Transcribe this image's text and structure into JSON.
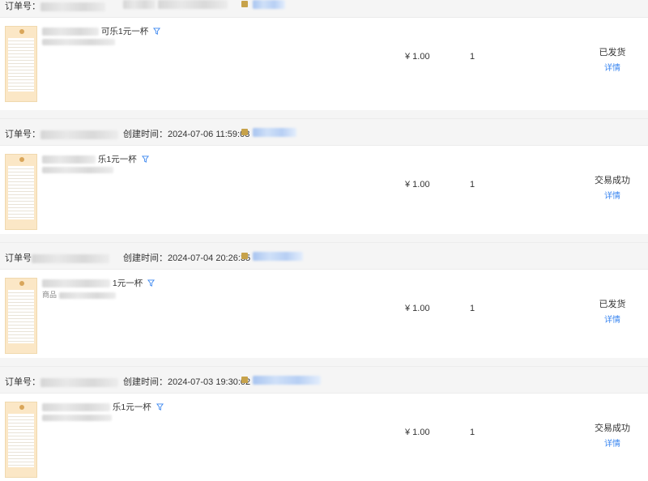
{
  "orders": [
    {
      "order_label": "订单号：",
      "created_label": "",
      "created_time": "",
      "title_tail": "可乐1元一杯",
      "sub_prefix": "",
      "price": "¥ 1.00",
      "quantity": "1",
      "status": "已发货",
      "detail_label": "详情"
    },
    {
      "order_label": "订单号：",
      "created_label": "创建时间：",
      "created_time": "2024-07-06 11:59:08",
      "title_tail": "乐1元一杯",
      "sub_prefix": "",
      "price": "¥ 1.00",
      "quantity": "1",
      "status": "交易成功",
      "detail_label": "详情"
    },
    {
      "order_label": "订单号",
      "created_label": "创建时间：",
      "created_time": "2024-07-04 20:26:35",
      "title_tail": "1元一杯",
      "sub_prefix": "商品",
      "price": "¥ 1.00",
      "quantity": "1",
      "status": "已发货",
      "detail_label": "详情"
    },
    {
      "order_label": "订单号：",
      "created_label": "创建时间：",
      "created_time": "2024-07-03 19:30:02",
      "title_tail": "乐1元一杯",
      "sub_prefix": "",
      "price": "¥ 1.00",
      "quantity": "1",
      "status": "交易成功",
      "detail_label": "详情"
    }
  ],
  "colors": {
    "link": "#3a86f0",
    "header_bg": "#f5f5f5",
    "shop_icon": "#c7a24a"
  },
  "icons": {
    "title_icon": "filter-icon",
    "shop_icon": "shop-icon"
  }
}
